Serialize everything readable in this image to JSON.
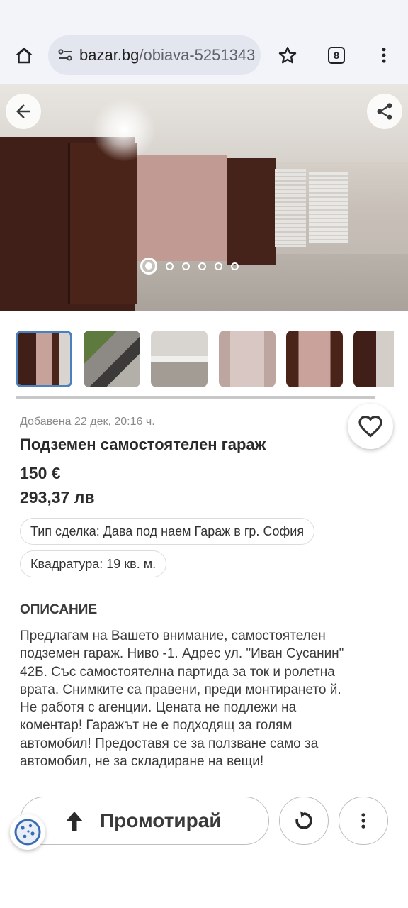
{
  "browser": {
    "url_domain": "bazar.bg",
    "url_path": "/obiava-5251343",
    "tab_count": "8",
    "icons": [
      "home-icon",
      "site-settings-icon",
      "bookmark-star-icon",
      "tab-switcher-icon",
      "more-vert-icon"
    ]
  },
  "gallery": {
    "photo_count": 6,
    "active_index": 0,
    "icons": [
      "back-arrow-icon",
      "share-icon"
    ]
  },
  "listing": {
    "added": "Добавена 22 дек, 20:16 ч.",
    "title": "Подземен самостоятелен гараж",
    "price_eur": "150 €",
    "price_bgn": "293,37 лв",
    "chips": [
      "Тип сделка: Дава под наем Гараж в гр. София",
      "Квадратура: 19 кв. м."
    ]
  },
  "description": {
    "heading": "ОПИСАНИЕ",
    "lines": [
      "Предлагам на Вашето внимание, самостоятелен",
      "подземен гараж. Ниво -1. Адрес ул. \"Иван Сусанин\"",
      "42Б. Със самостоятелна партида за ток и ролетна",
      "врата. Снимките са правени, преди монтирането й.",
      "Не работя с агенции. Цената не подлежи на",
      "коментар! Гаражът не е подходящ за голям",
      "автомобил! Предоставя се за ползване само за",
      "автомобил, не за складиране на вещи!"
    ]
  },
  "actions": {
    "promote_label": "Промотирай"
  },
  "colors": {
    "chrome_bg": "#f2f4fa",
    "url_pill": "#e3e6ee",
    "thumb_selected_border": "#4a7fc0",
    "text_dark": "#2b2b2b"
  }
}
